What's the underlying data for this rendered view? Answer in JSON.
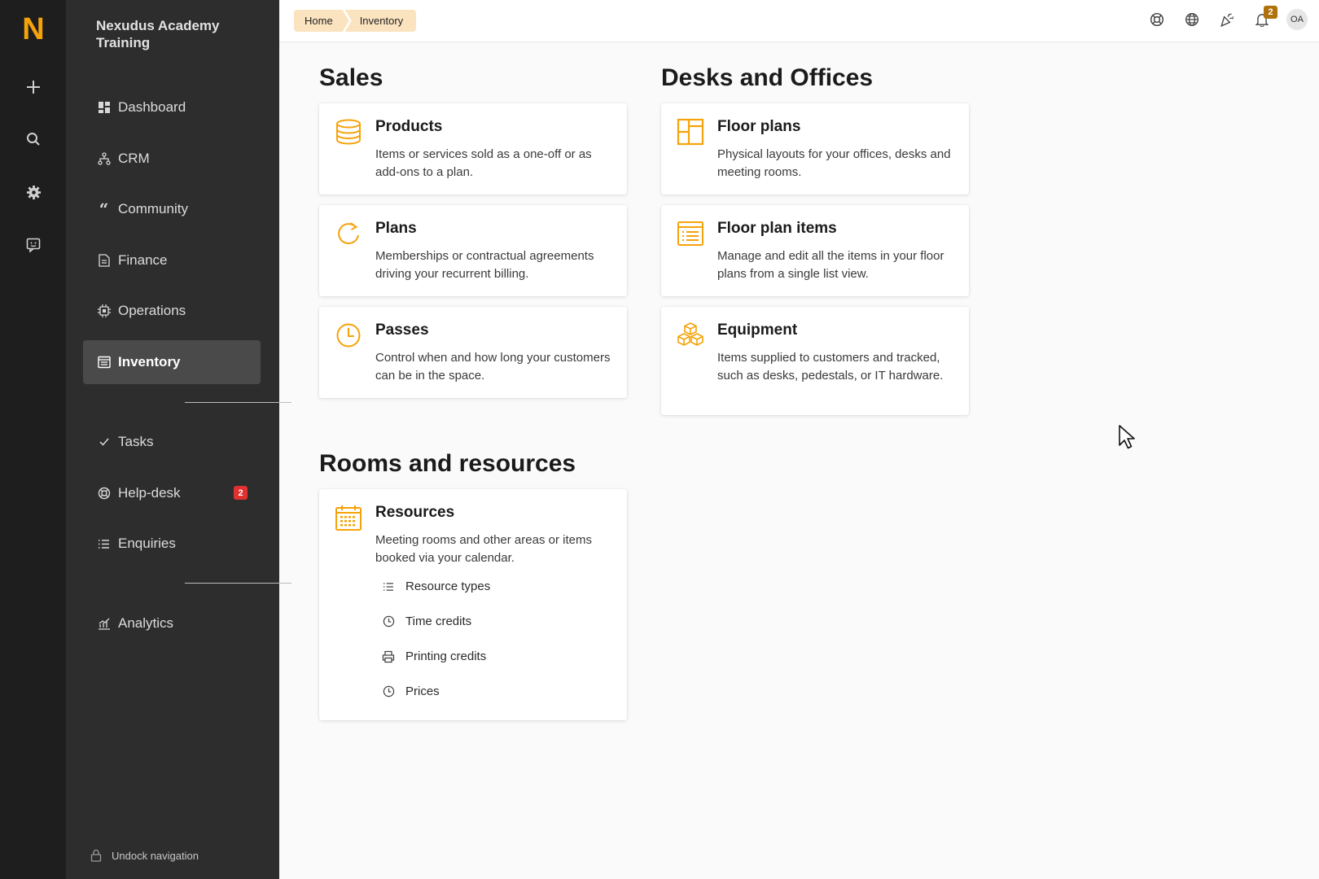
{
  "rail": {
    "logo": "N",
    "buttons": [
      {
        "name": "add-icon"
      },
      {
        "name": "search-icon"
      },
      {
        "name": "gear-icon"
      },
      {
        "name": "feedback-icon"
      }
    ]
  },
  "sidebar": {
    "title": "Nexudus Academy Training",
    "items": [
      {
        "label": "Dashboard",
        "icon": "dashboard-icon"
      },
      {
        "label": "CRM",
        "icon": "crm-icon"
      },
      {
        "label": "Community",
        "icon": "quote-icon"
      },
      {
        "label": "Finance",
        "icon": "document-icon"
      },
      {
        "label": "Operations",
        "icon": "chip-icon"
      },
      {
        "label": "Inventory",
        "icon": "inventory-icon",
        "active": true
      },
      {
        "label": "Tasks",
        "icon": "check-icon"
      },
      {
        "label": "Help-desk",
        "icon": "lifebuoy-icon",
        "badge": "2"
      },
      {
        "label": "Enquiries",
        "icon": "list-icon"
      },
      {
        "label": "Analytics",
        "icon": "chart-icon"
      }
    ],
    "undock_label": "Undock navigation"
  },
  "topbar": {
    "breadcrumb": [
      "Home",
      "Inventory"
    ],
    "notifications_count": "2",
    "avatar_initials": "OA"
  },
  "sections": {
    "sales": {
      "title": "Sales",
      "cards": [
        {
          "title": "Products",
          "desc": "Items or services sold as a one-off or as add-ons to a plan.",
          "icon": "database-icon"
        },
        {
          "title": "Plans",
          "desc": "Memberships or contractual agreements driving your recurrent billing.",
          "icon": "refresh-icon"
        },
        {
          "title": "Passes",
          "desc": "Control when and how long your customers can be in the space.",
          "icon": "clock-icon"
        }
      ]
    },
    "desks": {
      "title": "Desks and Offices",
      "cards": [
        {
          "title": "Floor plans",
          "desc": "Physical layouts for your offices, desks and meeting rooms.",
          "icon": "floorplan-icon"
        },
        {
          "title": "Floor plan items",
          "desc": "Manage and edit all the items in your floor plans from a single list view.",
          "icon": "list-window-icon"
        },
        {
          "title": "Equipment",
          "desc": "Items supplied to customers and tracked, such as desks, pedestals, or IT hardware.",
          "icon": "boxes-icon"
        }
      ]
    },
    "rooms": {
      "title": "Rooms and resources",
      "card": {
        "title": "Resources",
        "desc": "Meeting rooms and other areas or items booked via your calendar.",
        "icon": "calendar-icon",
        "links": [
          {
            "label": "Resource types",
            "icon": "list-icon"
          },
          {
            "label": "Time credits",
            "icon": "clock-icon"
          },
          {
            "label": "Printing credits",
            "icon": "printer-icon"
          },
          {
            "label": "Prices",
            "icon": "clock-icon"
          }
        ]
      }
    }
  },
  "colors": {
    "accent": "#f5a30a",
    "rail_bg": "#1e1e1e",
    "sidebar_bg": "#2d2d2d",
    "active_bg": "#4a4a4a",
    "breadcrumb_bg": "#fbe3bf",
    "badge_red": "#e0302f",
    "badge_brown": "#b0700a"
  }
}
